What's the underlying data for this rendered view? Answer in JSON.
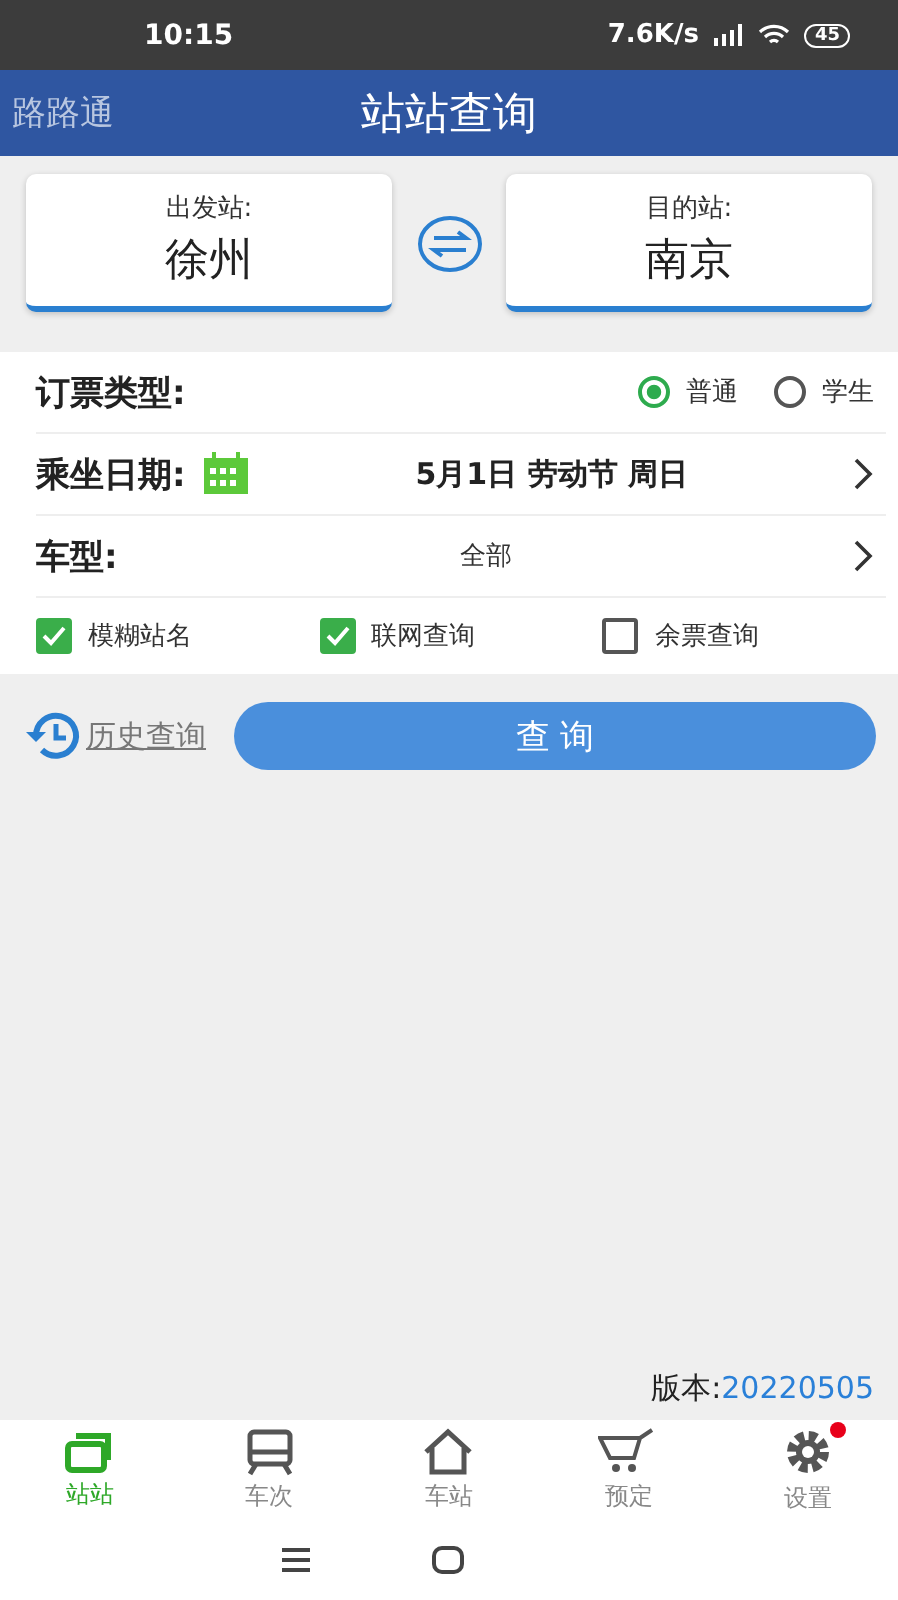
{
  "status_bar": {
    "time": "10:15",
    "speed": "7.6K/s",
    "battery": "45"
  },
  "header": {
    "app_name": "路路通",
    "title": "站站查询"
  },
  "stations": {
    "from": {
      "label": "出发站:",
      "value": "徐州"
    },
    "to": {
      "label": "目的站:",
      "value": "南京"
    }
  },
  "ticket_type": {
    "label": "订票类型:",
    "options": [
      {
        "label": "普通",
        "selected": true
      },
      {
        "label": "学生",
        "selected": false
      }
    ]
  },
  "date": {
    "label": "乘坐日期:",
    "value": "5月1日 劳动节 周日"
  },
  "train_type": {
    "label": "车型:",
    "value": "全部"
  },
  "options": [
    {
      "label": "模糊站名",
      "checked": true
    },
    {
      "label": "联网查询",
      "checked": true
    },
    {
      "label": "余票查询",
      "checked": false
    }
  ],
  "history_link": "历史查询",
  "search_button": "查 询",
  "version": {
    "label": "版本:",
    "value": "20220505"
  },
  "tabs": [
    {
      "label": "站站",
      "kind": "stations",
      "selected": true,
      "badge": false
    },
    {
      "label": "车次",
      "kind": "train",
      "selected": false,
      "badge": false
    },
    {
      "label": "车站",
      "kind": "home",
      "selected": false,
      "badge": false
    },
    {
      "label": "预定",
      "kind": "cart",
      "selected": false,
      "badge": false
    },
    {
      "label": "设置",
      "kind": "settings",
      "selected": false,
      "badge": true
    }
  ]
}
